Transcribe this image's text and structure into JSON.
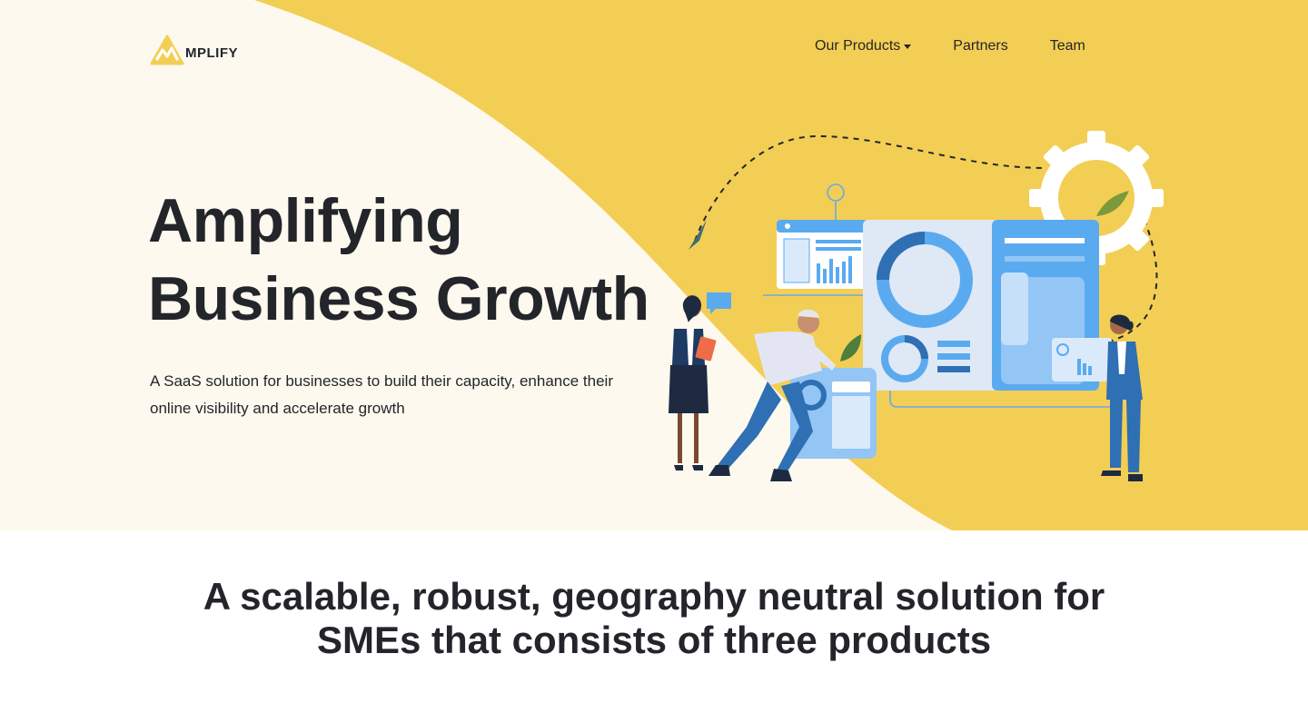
{
  "brand": {
    "logo_text": "MPLIFY",
    "accent": "#f3ce55",
    "cream": "#fdf9ee",
    "ink": "#23252b"
  },
  "nav": {
    "items": [
      {
        "label": "Our Products",
        "has_dropdown": true
      },
      {
        "label": "Partners",
        "has_dropdown": false
      },
      {
        "label": "Team",
        "has_dropdown": false
      }
    ]
  },
  "hero": {
    "title_line1": "Amplifying",
    "title_line2": "Business Growth",
    "subtitle": "A SaaS solution for businesses to build their capacity, enhance their online visibility and accelerate growth",
    "illustration": "business-team-dashboard-illustration"
  },
  "section": {
    "title_line1": "A scalable, robust, geography neutral solution for",
    "title_line2": "SMEs that consists of three products"
  }
}
